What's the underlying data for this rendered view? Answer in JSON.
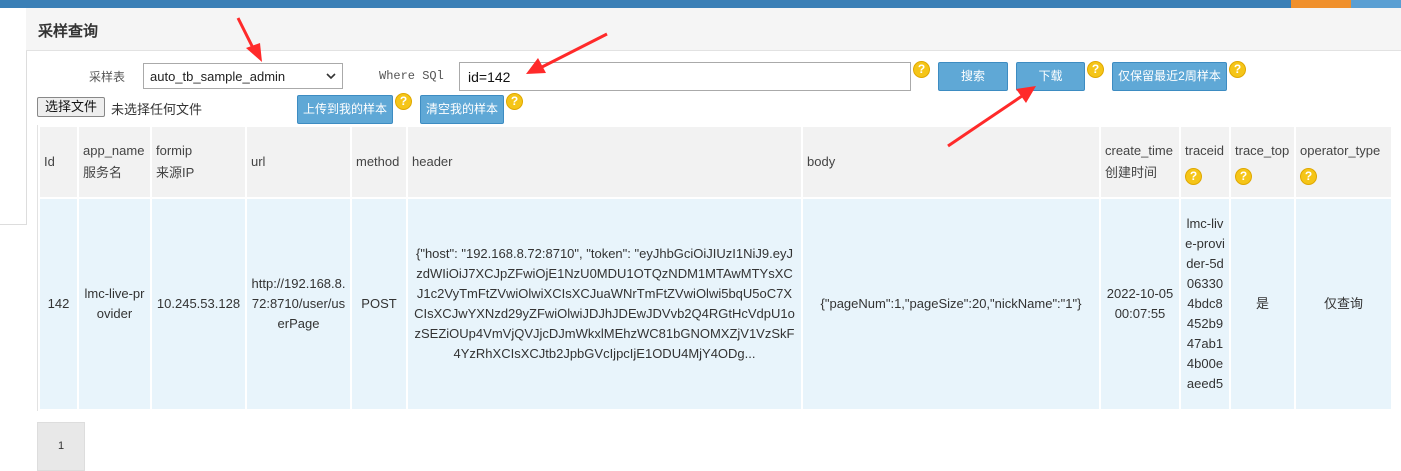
{
  "panel": {
    "title": "采样查询"
  },
  "form": {
    "sample_table_label": "采样表",
    "sample_table_value": "auto_tb_sample_admin",
    "where_label": "Where SQl",
    "where_value": "id=142",
    "search_label": "搜索",
    "download_label": "下载",
    "keep_recent_label": "仅保留最近2周样本",
    "choose_file_label": "选择文件",
    "no_file_text": "未选择任何文件",
    "upload_label": "上传到我的样本",
    "clear_label": "清空我的样本",
    "help_glyph": "?"
  },
  "table": {
    "columns": [
      {
        "key": "id",
        "line1": "Id",
        "line2": ""
      },
      {
        "key": "app_name",
        "line1": "app_name",
        "line2": "服务名"
      },
      {
        "key": "formip",
        "line1": "formip",
        "line2": "来源IP"
      },
      {
        "key": "url",
        "line1": "url",
        "line2": ""
      },
      {
        "key": "method",
        "line1": "method",
        "line2": ""
      },
      {
        "key": "header",
        "line1": "header",
        "line2": ""
      },
      {
        "key": "body",
        "line1": "body",
        "line2": ""
      },
      {
        "key": "create_time",
        "line1": "create_time",
        "line2": "创建时间"
      },
      {
        "key": "traceid",
        "line1": "traceid",
        "line2": ""
      },
      {
        "key": "trace_top",
        "line1": "trace_top",
        "line2": ""
      },
      {
        "key": "operator_type",
        "line1": "operator_type",
        "line2": ""
      }
    ],
    "rows": [
      {
        "id": "142",
        "app_name": "lmc-live-provider",
        "formip": "10.245.53.128",
        "url": "http://192.168.8.72:8710/user/userPage",
        "method": "POST",
        "header": "{\"host\": \"192.168.8.72:8710\", \"token\": \"eyJhbGciOiJIUzI1NiJ9.eyJzdWIiOiJ7XCJpZFwiOjE1NzU0MDU1OTQzNDM1MTAwMTYsXCJ1c2VyTmFtZVwiOlwiXCIsXCJuaWNrTmFtZVwiOlwi5bqU5oC7XCIsXCJwYXNzd29yZFwiOlwiJDJhJDEwJDVvb2Q4RGtHcVdpU1ozSEZiOUp4VmVjQVJjcDJmWkxlMEhzWC81bGNOMXZjV1VzSkF4YzRhXCIsXCJtb2JpbGVcIjpcIjE1ODU4MjY4ODg...",
        "body": "{\"pageNum\":1,\"pageSize\":20,\"nickName\":\"1\"}",
        "create_time": "2022-10-05 00:07:55",
        "traceid": "lmc-live-provider-5d063304bdc8452b947ab14b00eaeed5",
        "trace_top": "是",
        "operator_type": "仅查询"
      }
    ]
  },
  "pagination": {
    "current_page": "1"
  }
}
